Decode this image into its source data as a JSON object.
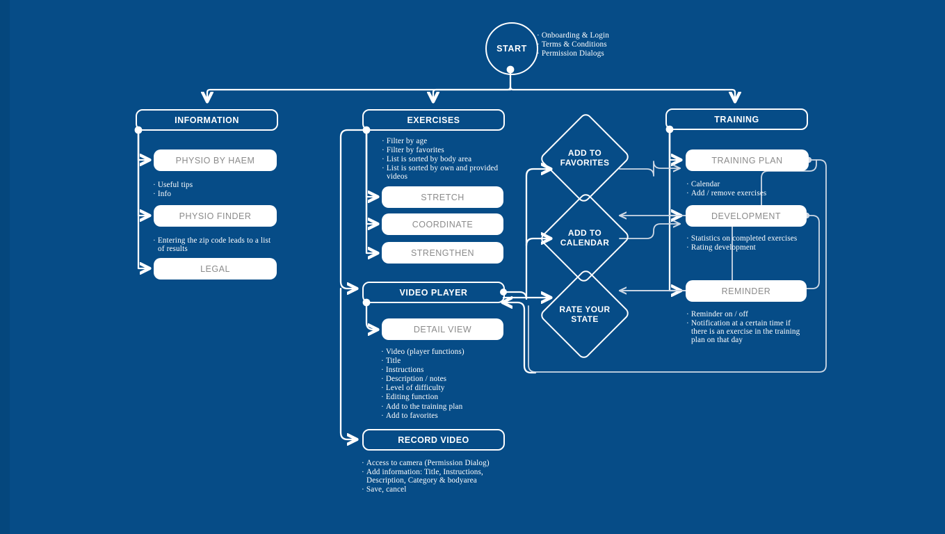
{
  "theme": {
    "background": "#064c87",
    "edge_strip": "#05477d",
    "line": "#ffffff",
    "filled_box_bg": "#ffffff",
    "filled_box_text": "#8b8b8b",
    "outline_text": "#ffffff"
  },
  "start": {
    "label": "START",
    "notes": [
      "Onboarding & Login",
      "Terms & Conditions",
      "Permission Dialogs"
    ]
  },
  "columns": {
    "information": {
      "header": "INFORMATION",
      "items": [
        {
          "label": "PHYSIO BY HAEM",
          "style": "filled"
        },
        {
          "label": "PHYSIO FINDER",
          "style": "filled"
        },
        {
          "label": "LEGAL",
          "style": "filled"
        }
      ],
      "notes_after_physio_by_haem": [
        "Useful tips",
        "Info"
      ],
      "notes_after_physio_finder": [
        "Entering the zip code leads to a list\nof results"
      ]
    },
    "exercises": {
      "header": "EXERCISES",
      "header_notes": [
        "Filter by age",
        "Filter by favorites",
        "List is sorted by body area",
        "List is sorted by own and provided\nvideos"
      ],
      "categories": [
        {
          "label": "STRETCH",
          "style": "filled"
        },
        {
          "label": "COORDINATE",
          "style": "filled"
        },
        {
          "label": "STRENGTHEN",
          "style": "filled"
        }
      ],
      "video_player": {
        "label": "VIDEO PLAYER",
        "style": "outline"
      },
      "detail_view": {
        "label": "DETAIL VIEW",
        "style": "filled"
      },
      "detail_view_notes": [
        "Video (player functions)",
        "Title",
        "Instructions",
        "Description / notes",
        "Level of difficulty",
        "Editing function",
        "Add to the training plan",
        "Add to favorites"
      ],
      "record_video": {
        "label": "RECORD VIDEO",
        "style": "outline"
      },
      "record_video_notes": [
        "Access to camera (Permission Dialog)",
        "Add information: Title, Instructions,\nDescription, Category & bodyarea",
        "Save, cancel"
      ]
    },
    "actions": {
      "diamonds": [
        {
          "label": "ADD TO\nFAVORITES"
        },
        {
          "label": "ADD TO\nCALENDAR"
        },
        {
          "label": "RATE YOUR\nSTATE"
        }
      ]
    },
    "training": {
      "header": "TRAINING",
      "items": [
        {
          "label": "TRAINING PLAN",
          "style": "filled"
        },
        {
          "label": "DEVELOPMENT",
          "style": "filled"
        },
        {
          "label": "REMINDER",
          "style": "filled"
        }
      ],
      "notes_after_training_plan": [
        "Calendar",
        "Add / remove exercises"
      ],
      "notes_after_development": [
        "Statistics on completed exercises",
        "Rating development"
      ],
      "notes_after_reminder": [
        "Reminder on / off",
        "Notification at a certain time if\nthere is an exercise in the training\nplan on that day"
      ]
    }
  }
}
